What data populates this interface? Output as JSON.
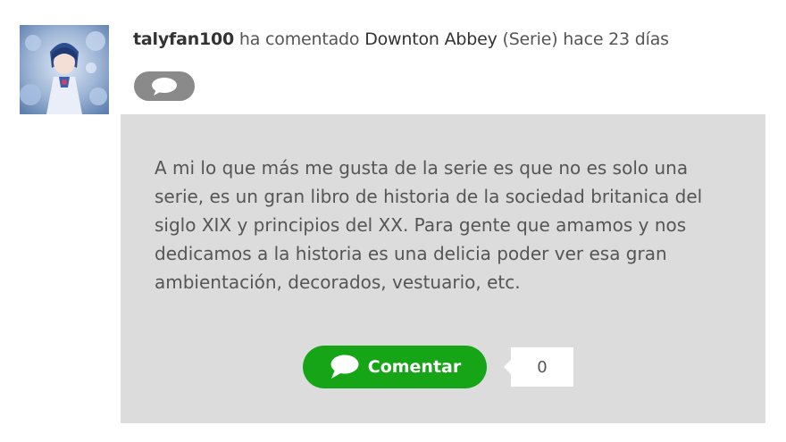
{
  "activity": {
    "username": "talyfan100",
    "action": "ha comentado",
    "title": "Downton Abbey",
    "type": "(Serie)",
    "time": "hace 23 días"
  },
  "comment": {
    "text": "A mi lo que más me gusta de la serie es que no es solo una serie, es un gran libro de historia de la sociedad britanica del siglo XIX y principios del XX. Para gente que amamos y nos dedicamos a la historia es una delicia poder ver esa gran ambientación, decorados, vestuario, etc.",
    "button_label": "Comentar",
    "count": "0"
  },
  "icons": {
    "toggle": "speech-bubble-icon",
    "button": "speech-bubble-icon"
  },
  "colors": {
    "card_background": "#dcdcdc",
    "button_green": "#16a516",
    "toggle_gray": "#8a8a8a"
  }
}
